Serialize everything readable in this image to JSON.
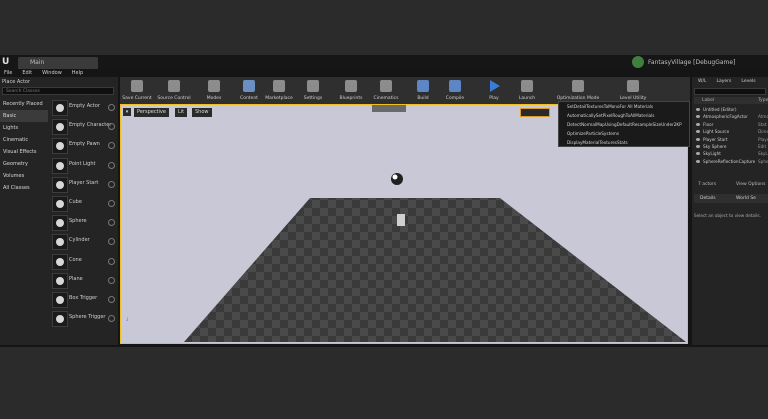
{
  "window": {
    "tab_title": "Main",
    "project_title": "FantasyVillage [DebugGame]",
    "menu": [
      "File",
      "Edit",
      "Window",
      "Help"
    ]
  },
  "modes": {
    "header": "Place Actor",
    "search_placeholder": "Search Classes",
    "categories": [
      "Recently Placed",
      "Basic",
      "Lights",
      "Cinematic",
      "Visual Effects",
      "Geometry",
      "Volumes",
      "All Classes"
    ],
    "selected_category": "Basic",
    "items": [
      "Empty Actor",
      "Empty Character",
      "Empty Pawn",
      "Point Light",
      "Player Start",
      "Cube",
      "Sphere",
      "Cylinder",
      "Cone",
      "Plane",
      "Box Trigger",
      "Sphere Trigger"
    ]
  },
  "toolbar": {
    "buttons": [
      "Save Current",
      "Source Control",
      "Modes",
      "Content",
      "Marketplace",
      "Settings",
      "Blueprints",
      "Cinematics",
      "Build",
      "Compile",
      "Play",
      "Launch",
      "Optimization Mode",
      "Level Utility"
    ]
  },
  "viewport": {
    "options_label": "▾",
    "perspective_label": "Perspective",
    "lit_label": "Lit",
    "show_label": "Show"
  },
  "dropdown": {
    "items": [
      "SetDetailTexturesToMonoFor All Materials",
      "AutomaticallySetPixelRoughToAllMaterials",
      "DetectNormalMapUsingDefaultResampleSizeUnder2KP",
      "OptimizeParticleSystems",
      "DisplayMaterialTexturesStats"
    ]
  },
  "outliner": {
    "tabs": [
      "W/L",
      "Layers",
      "Levels"
    ],
    "header_label": "Label",
    "header_type": "Type",
    "rows": [
      {
        "label": "Untitled (Editor)",
        "type": ""
      },
      {
        "label": "AtmosphericFogActor",
        "type": "Atmo"
      },
      {
        "label": "Floor",
        "type": "Stat"
      },
      {
        "label": "Light Source",
        "type": "Direc"
      },
      {
        "label": "Player Start",
        "type": "Playe"
      },
      {
        "label": "Sky Sphere",
        "type": "Edit"
      },
      {
        "label": "SkyLight",
        "type": "SkyL"
      },
      {
        "label": "SphereReflectionCapture",
        "type": "Sphe"
      }
    ],
    "actor_count": "7 actors",
    "view_options": "View Options"
  },
  "details": {
    "tab_details": "Details",
    "tab_world": "World Se",
    "empty_msg": "Select an object to view details."
  }
}
